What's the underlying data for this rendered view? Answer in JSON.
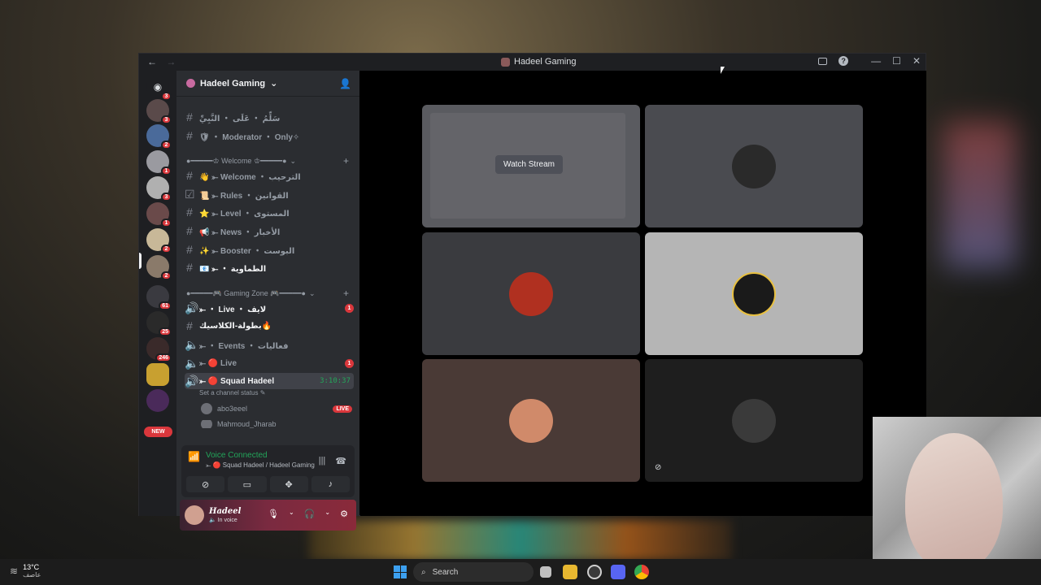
{
  "window": {
    "title": "Hadeel Gaming",
    "back": "←",
    "forward": "→",
    "help": "?",
    "minimize": "—",
    "maximize": "☐",
    "close": "✕"
  },
  "rail": {
    "servers": [
      {
        "badge": "3"
      },
      {
        "badge": "3"
      },
      {
        "badge": "2"
      },
      {
        "badge": "1"
      },
      {
        "badge": "3"
      },
      {
        "badge": "1"
      },
      {
        "badge": "2"
      },
      {
        "badge": "2"
      },
      {
        "badge": "61"
      },
      {
        "badge": "25"
      },
      {
        "badge": "246"
      },
      {
        "badge": ""
      },
      {
        "badge": ""
      }
    ],
    "new_label": "NEW"
  },
  "server": {
    "name": "Hadeel Gaming"
  },
  "channels": {
    "top": [
      {
        "label": "سَلِّمُ ・ عَلَى ・ النَّبِيِّ"
      },
      {
        "label": "🛡 ・ Moderator ・ Only✧"
      }
    ],
    "welcome_category": "●━━━━━♔ Welcome ♔━━━━━●",
    "welcome": [
      {
        "label": "👋 ⤜ Welcome ・ الترحيب"
      },
      {
        "label": "📜 ⤜ Rules ・ القوانين"
      },
      {
        "label": "⭐ ⤜ Level ・ المستوى"
      },
      {
        "label": "📢 ⤜ News ・ الأخبار"
      },
      {
        "label": "✨ ⤜ Booster ・ البوست"
      },
      {
        "label": "📧 ⤜ ・ الطماوية"
      }
    ],
    "gaming_category": "●━━━━━🎮 Gaming Zone 🎮━━━━━●",
    "gaming": [
      {
        "label": "⤜ ・ Live ・ لايف",
        "unread": "1"
      },
      {
        "label": "بطولة-الكلاسيك🔥"
      },
      {
        "label": "⤜ ・ Events ・ فعاليات"
      },
      {
        "label": "⤜ 🔴 Live",
        "unread": "1"
      },
      {
        "label": "⤜ 🔴 Squad Hadeel",
        "time": "3:10:37"
      }
    ],
    "channel_status": "Set a channel status ✎",
    "voice_users": [
      {
        "name": "abo3eeel",
        "live": "LIVE"
      },
      {
        "name": "Mahmoud_Jharab"
      }
    ]
  },
  "voice_panel": {
    "title": "Voice Connected",
    "subtitle": "⤜ 🔴 Squad Hadeel / Hadeel Gaming"
  },
  "user": {
    "name": "Hadeel",
    "status": "🔈 In voice"
  },
  "stage": {
    "watch_label": "Watch Stream",
    "tiles": [
      {
        "bg": "#5a5b60",
        "avatar": "#6a6a6a"
      },
      {
        "bg": "#4a4b50",
        "avatar": "#2a2a2a"
      },
      {
        "bg": "#3a3b3f",
        "avatar": "#b03020"
      },
      {
        "bg": "#b5b5b5",
        "avatar": "#1a1a1a"
      },
      {
        "bg": "#4a3a36",
        "avatar": "#d08a6a"
      },
      {
        "bg": "#1e1e1e",
        "avatar": "#3a3a3a"
      }
    ]
  },
  "taskbar": {
    "temperature": "13°C",
    "weather": "عاصف",
    "search_placeholder": "Search"
  }
}
